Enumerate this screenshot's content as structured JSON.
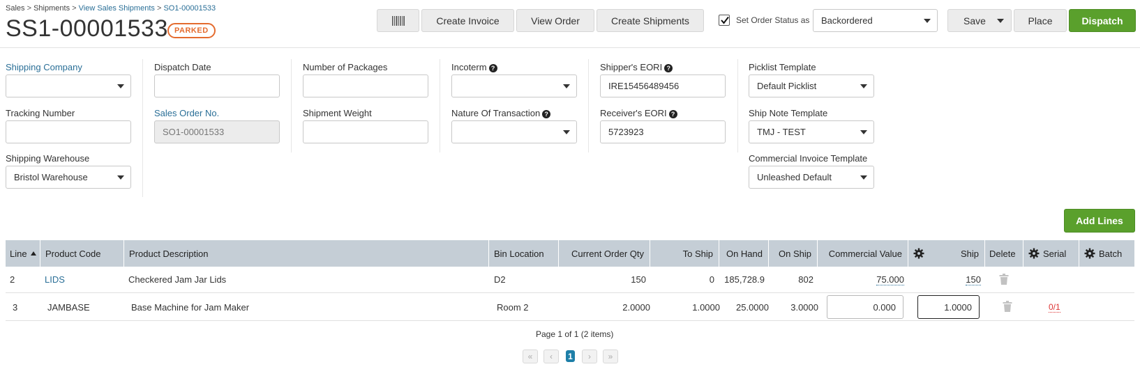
{
  "breadcrumb": {
    "items": [
      "Sales",
      "Shipments",
      "View Sales Shipments",
      "SO1-00001533"
    ],
    "separator": ">"
  },
  "header": {
    "title": "SS1-00001533",
    "status": "PARKED",
    "buttons": {
      "create_invoice": "Create Invoice",
      "view_order": "View Order",
      "create_shipments": "Create Shipments",
      "save": "Save",
      "place": "Place",
      "dispatch": "Dispatch"
    },
    "set_status_label": "Set Order Status as",
    "set_status_checked": true,
    "order_status_value": "Backordered"
  },
  "form": {
    "shipping_company": {
      "label": "Shipping Company",
      "value": ""
    },
    "tracking_number": {
      "label": "Tracking Number",
      "value": ""
    },
    "shipping_warehouse": {
      "label": "Shipping Warehouse",
      "value": "Bristol Warehouse"
    },
    "dispatch_date": {
      "label": "Dispatch Date",
      "value": ""
    },
    "sales_order_no": {
      "label": "Sales Order No.",
      "value": "SO1-00001533"
    },
    "number_of_packages": {
      "label": "Number of Packages",
      "value": ""
    },
    "shipment_weight": {
      "label": "Shipment Weight",
      "value": ""
    },
    "incoterm": {
      "label": "Incoterm",
      "value": ""
    },
    "nature_of_transaction": {
      "label": "Nature Of Transaction",
      "value": ""
    },
    "shippers_eori": {
      "label": "Shipper's EORI",
      "value": "IRE15456489456"
    },
    "receivers_eori": {
      "label": "Receiver's EORI",
      "value": "5723923"
    },
    "picklist_template": {
      "label": "Picklist Template",
      "value": "Default Picklist"
    },
    "ship_note_template": {
      "label": "Ship Note Template",
      "value": "TMJ - TEST"
    },
    "commercial_invoice_template": {
      "label": "Commercial Invoice Template",
      "value": "Unleashed Default"
    }
  },
  "add_lines_label": "Add Lines",
  "table": {
    "columns": [
      "Line",
      "Product Code",
      "Product Description",
      "Bin Location",
      "Current Order Qty",
      "To Ship",
      "On Hand",
      "On Ship",
      "Commercial Value",
      "Ship",
      "Delete",
      "Serial",
      "Batch"
    ],
    "rows": [
      {
        "line": "2",
        "product_code": "LIDS",
        "description": "Checkered Jam Jar Lids",
        "bin": "D2",
        "order_qty": "150",
        "to_ship": "0",
        "on_hand": "185,728.9",
        "on_ship": "802",
        "commercial_value": "75.000",
        "ship": "150",
        "serial": ""
      },
      {
        "line": "3",
        "product_code": "JAMBASE",
        "description": "Base Machine for Jam Maker",
        "bin": "Room 2",
        "order_qty": "2.0000",
        "to_ship": "1.0000",
        "on_hand": "25.0000",
        "on_ship": "3.0000",
        "commercial_value": "0.000",
        "ship": "1.0000",
        "serial": "0/1"
      }
    ]
  },
  "pagination": {
    "summary": "Page 1 of 1 (2 items)",
    "current_page": "1"
  }
}
